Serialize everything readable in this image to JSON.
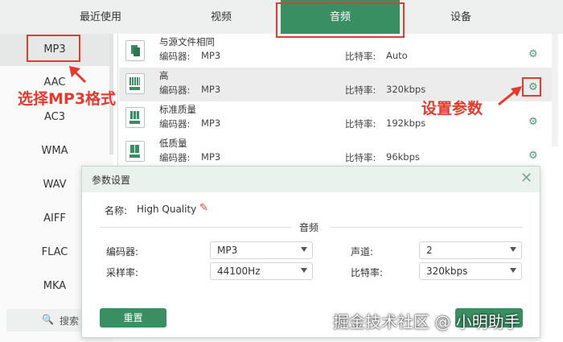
{
  "tabs": [
    {
      "label": "最近使用"
    },
    {
      "label": "视频"
    },
    {
      "label": "音频"
    },
    {
      "label": "设备"
    }
  ],
  "active_tab": "音频",
  "formats": [
    "MP3",
    "AAC",
    "AC3",
    "WMA",
    "WAV",
    "AIFF",
    "FLAC",
    "MKA"
  ],
  "selected_format": "MP3",
  "search_label": "搜索",
  "presets": [
    {
      "name": "与源文件相同",
      "codec_label": "编码器:",
      "codec": "MP3",
      "bitrate_label": "比特率:",
      "bitrate": "Auto"
    },
    {
      "name": "高",
      "codec_label": "编码器:",
      "codec": "MP3",
      "bitrate_label": "比特率:",
      "bitrate": "320kbps"
    },
    {
      "name": "标准质量",
      "codec_label": "编码器:",
      "codec": "MP3",
      "bitrate_label": "比特率:",
      "bitrate": "192kbps"
    },
    {
      "name": "低质量",
      "codec_label": "编码器:",
      "codec": "MP3",
      "bitrate_label": "比特率:",
      "bitrate": "96kbps"
    }
  ],
  "annotations": {
    "select_mp3": "选择MP3格式",
    "set_params": "设置参数"
  },
  "dialog": {
    "title": "参数设置",
    "name_label": "名称:",
    "name_value": "High Quality",
    "section_label": "音频",
    "encoder_label": "编码器:",
    "encoder_value": "MP3",
    "samplerate_label": "采样率:",
    "samplerate_value": "44100Hz",
    "channel_label": "声道:",
    "channel_value": "2",
    "bitrate_label": "比特率:",
    "bitrate_value": "320kbps",
    "reset_label": "重置"
  },
  "watermark": "掘金技术社区 @ 小明助手",
  "colors": {
    "accent": "#3a8f62",
    "annotation": "#e63a2e"
  }
}
